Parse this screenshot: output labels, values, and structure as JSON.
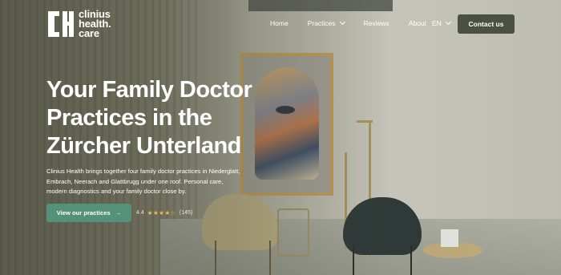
{
  "brand": {
    "line1": "clinius",
    "line2": "health.",
    "line3": "care",
    "mark": "IH"
  },
  "nav": {
    "items": [
      {
        "label": "Home"
      },
      {
        "label": "Practices"
      },
      {
        "label": "Reviews"
      },
      {
        "label": "About"
      }
    ],
    "language": "EN",
    "contact_label": "Contact us"
  },
  "hero": {
    "title_lines": [
      "Your Family Doctor",
      "Practices in the",
      "Zürcher Unterland"
    ],
    "description_lines": [
      "Clinius Health brings together four family doctor practices in Niederglatt,",
      "Embrach, Neerach and Glattbrugg under one roof. Personal care,",
      "modern diagnostics and your family doctor close by."
    ],
    "cta_label": "View our practices",
    "cta_arrow": "→",
    "rating": {
      "score": "4.4",
      "stars": "★★★★☆",
      "count": "(145)"
    }
  },
  "colors": {
    "cta": "#55917a",
    "contact": "#4a5142",
    "star": "#f0c24b"
  }
}
